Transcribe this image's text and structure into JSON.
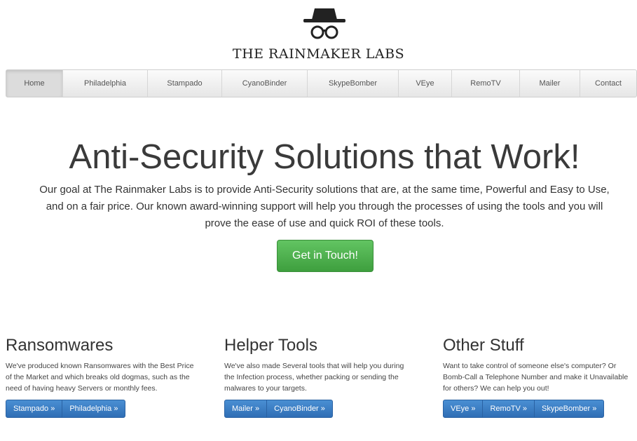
{
  "logo": {
    "text": "THE RAINMAKER LABS",
    "icon": "spy-hat-glasses-icon"
  },
  "nav": {
    "items": [
      "Home",
      "Philadelphia",
      "Stampado",
      "CyanoBinder",
      "SkypeBomber",
      "VEye",
      "RemoTV",
      "Mailer",
      "Contact"
    ],
    "active": "Home"
  },
  "hero": {
    "title": "Anti-Security Solutions that Work!",
    "text": "Our goal at The Rainmaker Labs is to provide Anti-Security solutions that are, at the same time, Powerful and Easy to Use, and on a fair price. Our known award-winning support will help you through the processes of using the tools and you will prove the ease of use and quick ROI of these tools.",
    "cta": "Get in Touch!"
  },
  "columns": [
    {
      "title": "Ransomwares",
      "lines": [
        "We've produced known Ransomwares with the Best Price",
        "of the Market and which breaks old dogmas, such as the",
        "need of having heavy Servers or monthly fees."
      ],
      "buttons": [
        "Stampado »",
        "Philadelphia »"
      ]
    },
    {
      "title": "Helper Tools",
      "lines": [
        "We've also made Several tools that will help you during",
        "the Infection process, whether packing or sending the",
        "malwares to your targets."
      ],
      "buttons": [
        "Mailer »",
        "CyanoBinder »"
      ]
    },
    {
      "title": "Other Stuff",
      "lines": [
        "Want to take control of someone else's computer? Or",
        "Bomb-Call a Telephone Number and make it Unavailable",
        "for others? We can help you out!"
      ],
      "buttons": [
        "VEye »",
        "RemoTV »",
        "SkypeBomber »"
      ]
    }
  ],
  "colors": {
    "nav_bg": "#e6e6e6",
    "cta_green": "#4cae4c",
    "button_blue": "#337ab7"
  }
}
